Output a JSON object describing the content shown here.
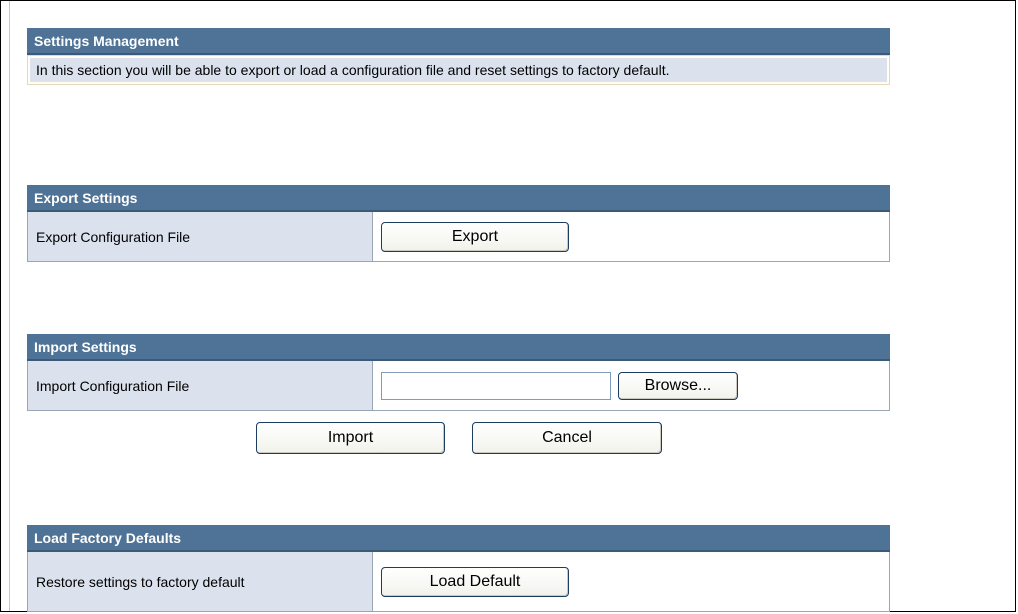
{
  "management": {
    "title": "Settings Management",
    "description": "In this section you will be able to export or load a configuration file and reset settings to factory default."
  },
  "export": {
    "title": "Export Settings",
    "label": "Export Configuration File",
    "button": "Export"
  },
  "import": {
    "title": "Import Settings",
    "label": "Import Configuration File",
    "file_value": "",
    "browse_button": "Browse...",
    "import_button": "Import",
    "cancel_button": "Cancel"
  },
  "factory": {
    "title": "Load Factory Defaults",
    "label": "Restore settings to factory default",
    "button": "Load Default"
  },
  "colors": {
    "header_bg": "#4f7396",
    "label_bg": "#dbe2ee"
  }
}
